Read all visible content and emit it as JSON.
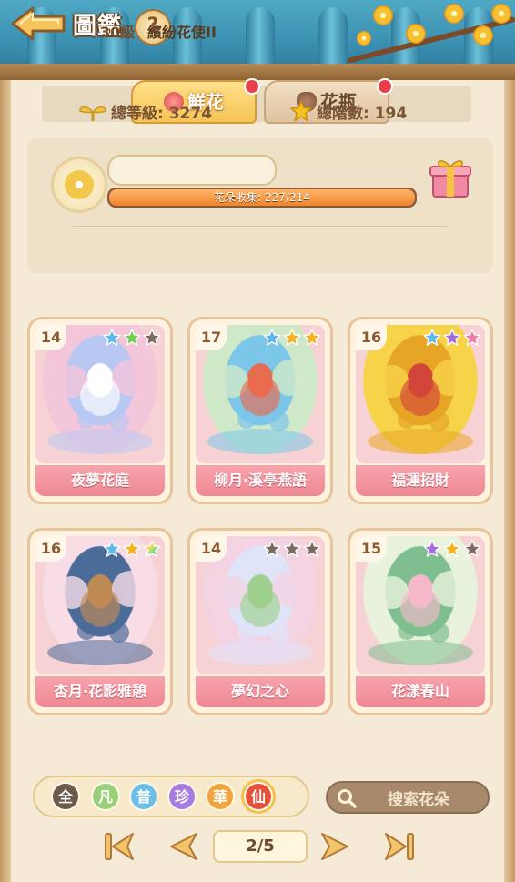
{
  "header": {
    "title": "圖鑑",
    "help_label": "?"
  },
  "tabs": [
    {
      "label": "鮮花",
      "active": true,
      "badge": true
    },
    {
      "label": "花瓶",
      "active": false,
      "badge": true
    }
  ],
  "profile": {
    "level": "30級",
    "title": "繽紛花使II",
    "progress_label": "花朵收集: 227/214",
    "progress_fraction": 1.0,
    "total_level_label": "總等級: 3274",
    "total_stage_label": "總階數: 194"
  },
  "cards": [
    {
      "level": "14",
      "name": "夜夢花庭",
      "stars": [
        "blue",
        "green",
        "gray"
      ],
      "palette": [
        "#f4c6d9",
        "#b9c8f2",
        "#ffffff"
      ]
    },
    {
      "level": "17",
      "name": "柳月·溪亭燕語",
      "stars": [
        "blue",
        "gold",
        "gold"
      ],
      "palette": [
        "#cfe9c8",
        "#7cc6ea",
        "#e86c4f"
      ]
    },
    {
      "level": "16",
      "name": "福運招財",
      "stars": [
        "blue",
        "purple",
        "pink"
      ],
      "palette": [
        "#f7d34a",
        "#e7a526",
        "#d2463a"
      ]
    },
    {
      "level": "16",
      "name": "杏月·花影雅憩",
      "stars": [
        "blue",
        "gold",
        "rainbow"
      ],
      "palette": [
        "#f8dde6",
        "#4b6b99",
        "#c08a54"
      ]
    },
    {
      "level": "14",
      "name": "夢幻之心",
      "stars": [
        "gray",
        "gray",
        "gray"
      ],
      "palette": [
        "#f3d3e2",
        "#e0e4f8",
        "#9fcf8e"
      ]
    },
    {
      "level": "15",
      "name": "花漾春山",
      "stars": [
        "purple",
        "gold",
        "gray"
      ],
      "palette": [
        "#e9f2dc",
        "#7fbf8f",
        "#f5b8c9"
      ]
    }
  ],
  "filters": [
    {
      "label": "全",
      "color": "#6e5a4a"
    },
    {
      "label": "凡",
      "color": "#9ad07a"
    },
    {
      "label": "普",
      "color": "#6cc0e8"
    },
    {
      "label": "珍",
      "color": "#a77ce0"
    },
    {
      "label": "華",
      "color": "#f2a33a"
    },
    {
      "label": "仙",
      "color": "#e8503a",
      "selected": true
    }
  ],
  "search": {
    "placeholder": "搜索花朵"
  },
  "pagination": {
    "label": "2/5"
  },
  "icons": {
    "back": "back-arrow-icon",
    "help": "question-icon",
    "gift": "gift-box-icon",
    "sprout": "sprout-icon",
    "star": "star-icon",
    "search": "magnifier-icon",
    "first": "first-page-icon",
    "prev": "prev-page-icon",
    "next": "next-page-icon",
    "last": "last-page-icon"
  },
  "colors": {
    "star_blue": "#5eb8f0",
    "star_green": "#6fcf4f",
    "star_gold": "#f6b21d",
    "star_purple": "#a46be0",
    "star_pink": "#f07aa8",
    "star_gray": "#7a6a62"
  }
}
